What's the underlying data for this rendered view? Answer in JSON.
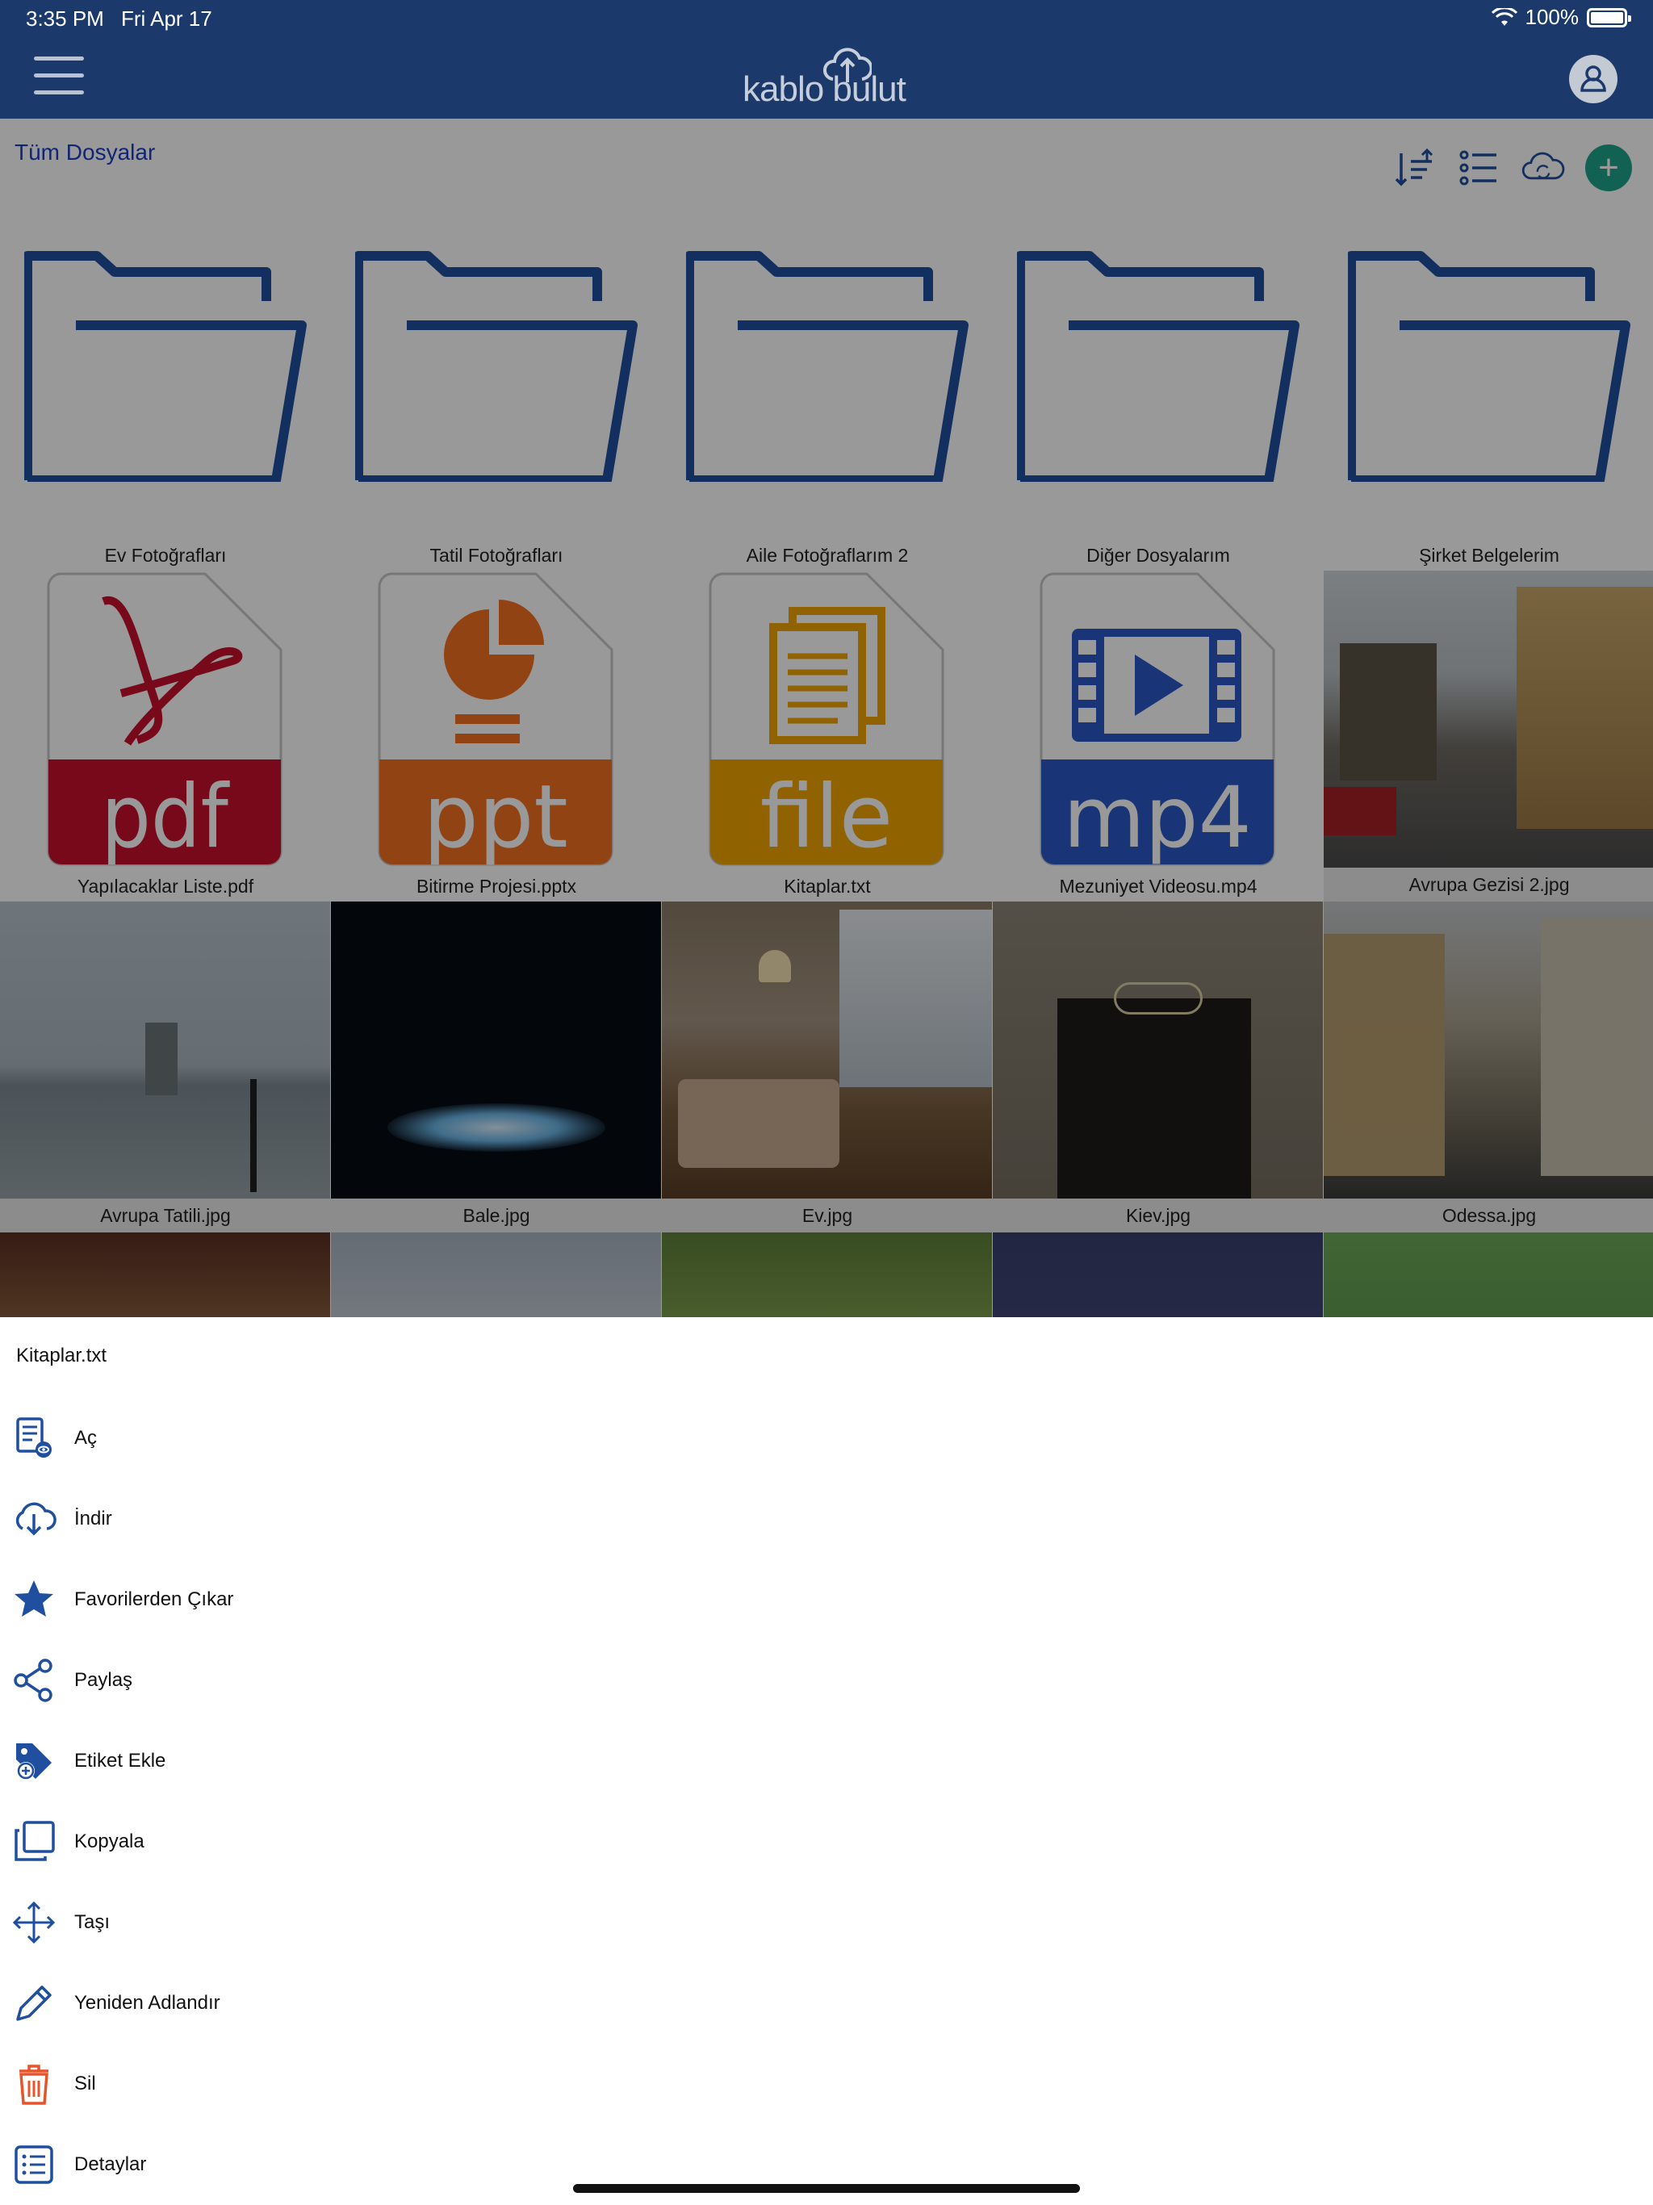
{
  "status_bar": {
    "time": "3:35 PM",
    "date": "Fri Apr 17",
    "battery": "100%"
  },
  "app": {
    "logo": "kablo bulut",
    "menu_icon": "hamburger-icon",
    "profile_icon": "user-icon"
  },
  "breadcrumb": "Tüm Dosyalar",
  "toolbar": {
    "sort_icon": "sort-icon",
    "list_icon": "list-view-icon",
    "sync_icon": "cloud-sync-icon",
    "add_label": "+"
  },
  "colors": {
    "header": "#1b3a6b",
    "accent": "#1fa38a",
    "icon_blue": "#1f4f9e",
    "delete": "#e8542a"
  },
  "folders": [
    {
      "name": "Ev Fotoğrafları"
    },
    {
      "name": "Tatil Fotoğrafları"
    },
    {
      "name": "Aile Fotoğraflarım 2"
    },
    {
      "name": "Diğer Dosyalarım"
    },
    {
      "name": "Şirket Belgelerim"
    }
  ],
  "files": [
    {
      "name": "Yapılacaklar Liste.pdf",
      "ext": "pdf",
      "color": "#c8102e"
    },
    {
      "name": "Bitirme Projesi.pptx",
      "ext": "ppt",
      "color": "#f37021"
    },
    {
      "name": "Kitaplar.txt",
      "ext": "file",
      "color": "#f0a500"
    },
    {
      "name": "Mezuniyet Videosu.mp4",
      "ext": "mp4",
      "color": "#2a57c6"
    }
  ],
  "photos": [
    {
      "name": "Avrupa Gezisi 2.jpg"
    },
    {
      "name": "Avrupa Tatili.jpg"
    },
    {
      "name": "Bale.jpg"
    },
    {
      "name": "Ev.jpg"
    },
    {
      "name": "Kiev.jpg"
    },
    {
      "name": "Odessa.jpg"
    }
  ],
  "sheet": {
    "title": "Kitaplar.txt",
    "actions": [
      {
        "label": "Aç",
        "icon": "open-file-icon"
      },
      {
        "label": "İndir",
        "icon": "download-icon"
      },
      {
        "label": "Favorilerden Çıkar",
        "icon": "star-icon"
      },
      {
        "label": "Paylaş",
        "icon": "share-icon"
      },
      {
        "label": "Etiket Ekle",
        "icon": "tag-add-icon"
      },
      {
        "label": "Kopyala",
        "icon": "copy-icon"
      },
      {
        "label": "Taşı",
        "icon": "move-icon"
      },
      {
        "label": "Yeniden Adlandır",
        "icon": "pencil-icon"
      },
      {
        "label": "Sil",
        "icon": "trash-icon"
      },
      {
        "label": "Detaylar",
        "icon": "details-icon"
      }
    ]
  }
}
